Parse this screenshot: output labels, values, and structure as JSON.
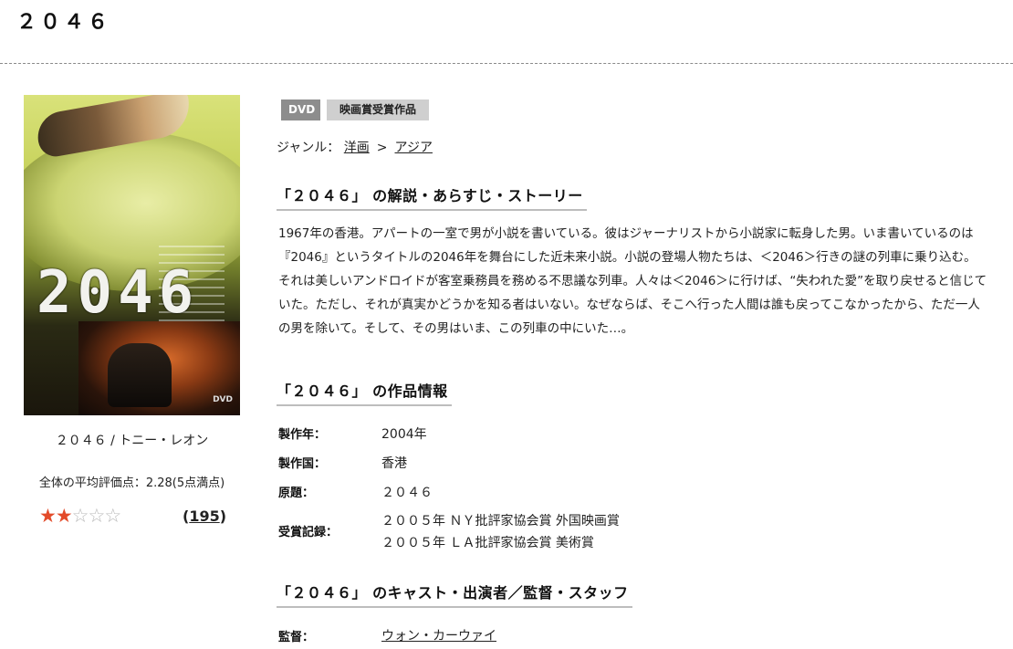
{
  "page": {
    "title": "２０４６"
  },
  "poster": {
    "image_alt_text": "2046",
    "caption": "２０４６ / トニー・レオン",
    "average_rating_text": "全体の平均評価点：2.28(5点満点)",
    "rating": {
      "value": 2.28,
      "max": 5,
      "filled_stars": 2
    },
    "review_count": "195"
  },
  "badges": {
    "format": "DVD",
    "award": "映画賞受賞作品"
  },
  "genre": {
    "label": "ジャンル：",
    "items": [
      "洋画",
      "アジア"
    ],
    "separator": ">"
  },
  "synopsis": {
    "heading": "「２０４６」 の解説・あらすじ・ストーリー",
    "text": "1967年の香港。アパートの一室で男が小説を書いている。彼はジャーナリストから小説家に転身した男。いま書いているのは『2046』というタイトルの2046年を舞台にした近未来小説。小説の登場人物たちは、＜2046＞行きの謎の列車に乗り込む。それは美しいアンドロイドが客室乗務員を務める不思議な列車。人々は＜2046＞に行けば、“失われた愛”を取り戻せると信じていた。ただし、それが真実かどうかを知る者はいない。なぜならば、そこへ行った人間は誰も戻ってこなかったから、ただ一人の男を除いて。そして、その男はいま、この列車の中にいた…。"
  },
  "work_info": {
    "heading": "「２０４６」 の作品情報",
    "year_label": "製作年：",
    "year": "2004年",
    "country_label": "製作国：",
    "country": "香港",
    "original_title_label": "原題：",
    "original_title": "２０４６",
    "awards_label": "受賞記録：",
    "awards": [
      "２００５年 ＮＹ批評家協会賞 外国映画賞",
      "２００５年 ＬＡ批評家協会賞 美術賞"
    ]
  },
  "cast": {
    "heading": "「２０４６」 のキャスト・出演者／監督・スタッフ",
    "director_label": "監督：",
    "director": "ウォン・カーウァイ"
  }
}
